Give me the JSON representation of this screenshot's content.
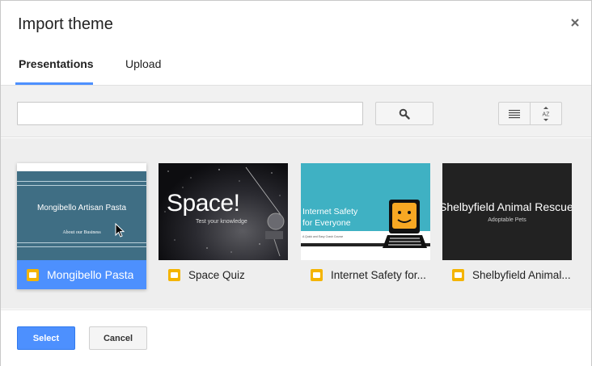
{
  "dialog": {
    "title": "Import theme",
    "close_icon": "close-icon"
  },
  "tabs": [
    {
      "label": "Presentations",
      "active": true
    },
    {
      "label": "Upload",
      "active": false
    }
  ],
  "toolbar": {
    "search_placeholder": "",
    "search_icon": "search-icon",
    "list_view_icon": "list-view-icon",
    "sort_icon": "sort-az-icon",
    "sort_label": "AZ"
  },
  "themes": [
    {
      "name": "Mongibello Pasta",
      "selected": true,
      "thumb_title": "Mongibello Artisan Pasta",
      "thumb_subtitle": "About our Business"
    },
    {
      "name": "Space Quiz",
      "selected": false,
      "thumb_title": "Space!",
      "thumb_subtitle": "Test your knowledge"
    },
    {
      "name": "Internet Safety for...",
      "selected": false,
      "thumb_title_line1": "Internet Safety",
      "thumb_title_line2": "for Everyone",
      "thumb_subtitle": "A Quick and Easy Crash Course"
    },
    {
      "name": "Shelbyfield Animal...",
      "selected": false,
      "thumb_title": "Shelbyfield Animal Rescue",
      "thumb_subtitle": "Adoptable Pets"
    }
  ],
  "footer": {
    "select_label": "Select",
    "cancel_label": "Cancel"
  },
  "colors": {
    "accent": "#4d90fe",
    "slides_icon": "#f4b400"
  }
}
